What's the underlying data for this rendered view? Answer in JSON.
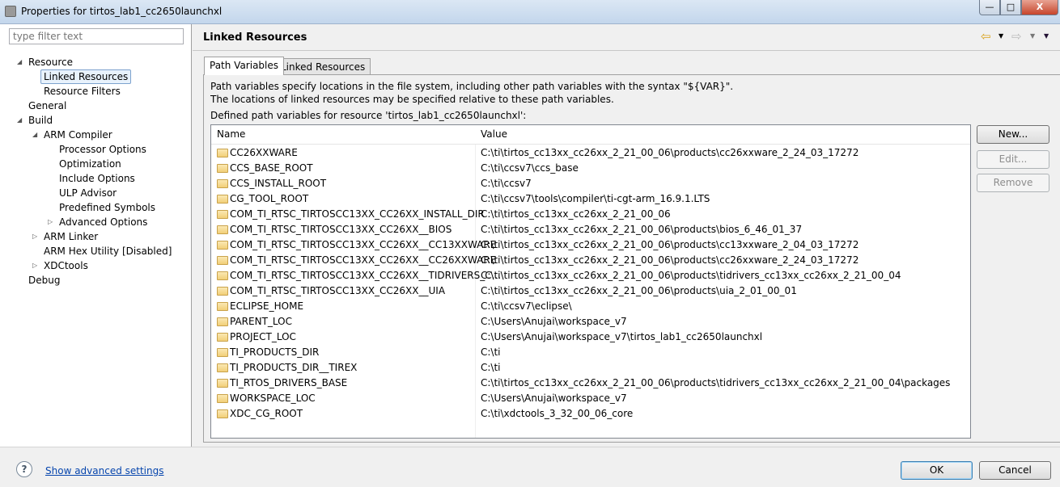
{
  "window": {
    "title": "Properties for tirtos_lab1_cc2650launchxl",
    "minimize": "—",
    "maximize": "□",
    "close": "X"
  },
  "filter": {
    "placeholder": "type filter text"
  },
  "tree": [
    {
      "label": "Resource",
      "level": 0,
      "arrow": "◢"
    },
    {
      "label": "Linked Resources",
      "level": 1,
      "selected": true
    },
    {
      "label": "Resource Filters",
      "level": 1
    },
    {
      "label": "General",
      "level": 0
    },
    {
      "label": "Build",
      "level": 0,
      "arrow": "◢"
    },
    {
      "label": "ARM Compiler",
      "level": 1,
      "arrow": "◢"
    },
    {
      "label": "Processor Options",
      "level": 2
    },
    {
      "label": "Optimization",
      "level": 2
    },
    {
      "label": "Include Options",
      "level": 2
    },
    {
      "label": "ULP Advisor",
      "level": 2
    },
    {
      "label": "Predefined Symbols",
      "level": 2
    },
    {
      "label": "Advanced Options",
      "level": 2,
      "arrow": "▷"
    },
    {
      "label": "ARM Linker",
      "level": 1,
      "arrow": "▷"
    },
    {
      "label": "ARM Hex Utility  [Disabled]",
      "level": 1
    },
    {
      "label": "XDCtools",
      "level": 1,
      "arrow": "▷"
    },
    {
      "label": "Debug",
      "level": 0
    }
  ],
  "header": {
    "title": "Linked Resources",
    "back": "⇦",
    "fwd": "⇨",
    "menu": "▼"
  },
  "tabs": [
    {
      "label": "Path Variables",
      "active": true
    },
    {
      "label": "Linked Resources"
    }
  ],
  "description": {
    "line1": "Path variables specify locations in the file system, including other path variables with the syntax \"${VAR}\".",
    "line2": "The locations of linked resources may be specified relative to these path variables.",
    "defined": "Defined path variables for resource 'tirtos_lab1_cc2650launchxl':"
  },
  "table": {
    "columns": [
      "Name",
      "Value"
    ],
    "rows": [
      [
        "CC26XXWARE",
        "C:\\ti\\tirtos_cc13xx_cc26xx_2_21_00_06\\products\\cc26xxware_2_24_03_17272"
      ],
      [
        "CCS_BASE_ROOT",
        "C:\\ti\\ccsv7\\ccs_base"
      ],
      [
        "CCS_INSTALL_ROOT",
        "C:\\ti\\ccsv7"
      ],
      [
        "CG_TOOL_ROOT",
        "C:\\ti\\ccsv7\\tools\\compiler\\ti-cgt-arm_16.9.1.LTS"
      ],
      [
        "COM_TI_RTSC_TIRTOSCC13XX_CC26XX_INSTALL_DIR",
        "C:\\ti\\tirtos_cc13xx_cc26xx_2_21_00_06"
      ],
      [
        "COM_TI_RTSC_TIRTOSCC13XX_CC26XX__BIOS",
        "C:\\ti\\tirtos_cc13xx_cc26xx_2_21_00_06\\products\\bios_6_46_01_37"
      ],
      [
        "COM_TI_RTSC_TIRTOSCC13XX_CC26XX__CC13XXWARE",
        "C:\\ti\\tirtos_cc13xx_cc26xx_2_21_00_06\\products\\cc13xxware_2_04_03_17272"
      ],
      [
        "COM_TI_RTSC_TIRTOSCC13XX_CC26XX__CC26XXWARE",
        "C:\\ti\\tirtos_cc13xx_cc26xx_2_21_00_06\\products\\cc26xxware_2_24_03_17272"
      ],
      [
        "COM_TI_RTSC_TIRTOSCC13XX_CC26XX__TIDRIVERS_C...",
        "C:\\ti\\tirtos_cc13xx_cc26xx_2_21_00_06\\products\\tidrivers_cc13xx_cc26xx_2_21_00_04"
      ],
      [
        "COM_TI_RTSC_TIRTOSCC13XX_CC26XX__UIA",
        "C:\\ti\\tirtos_cc13xx_cc26xx_2_21_00_06\\products\\uia_2_01_00_01"
      ],
      [
        "ECLIPSE_HOME",
        "C:\\ti\\ccsv7\\eclipse\\"
      ],
      [
        "PARENT_LOC",
        "C:\\Users\\Anujai\\workspace_v7"
      ],
      [
        "PROJECT_LOC",
        "C:\\Users\\Anujai\\workspace_v7\\tirtos_lab1_cc2650launchxl"
      ],
      [
        "TI_PRODUCTS_DIR",
        "C:\\ti"
      ],
      [
        "TI_PRODUCTS_DIR__TIREX",
        "C:\\ti"
      ],
      [
        "TI_RTOS_DRIVERS_BASE",
        "C:\\ti\\tirtos_cc13xx_cc26xx_2_21_00_06\\products\\tidrivers_cc13xx_cc26xx_2_21_00_04\\packages"
      ],
      [
        "WORKSPACE_LOC",
        "C:\\Users\\Anujai\\workspace_v7"
      ],
      [
        "XDC_CG_ROOT",
        "C:\\ti\\xdctools_3_32_00_06_core"
      ]
    ]
  },
  "buttons": {
    "new": "New...",
    "edit": "Edit...",
    "remove": "Remove"
  },
  "footer": {
    "help": "?",
    "advanced": "Show advanced settings",
    "ok": "OK",
    "cancel": "Cancel"
  }
}
